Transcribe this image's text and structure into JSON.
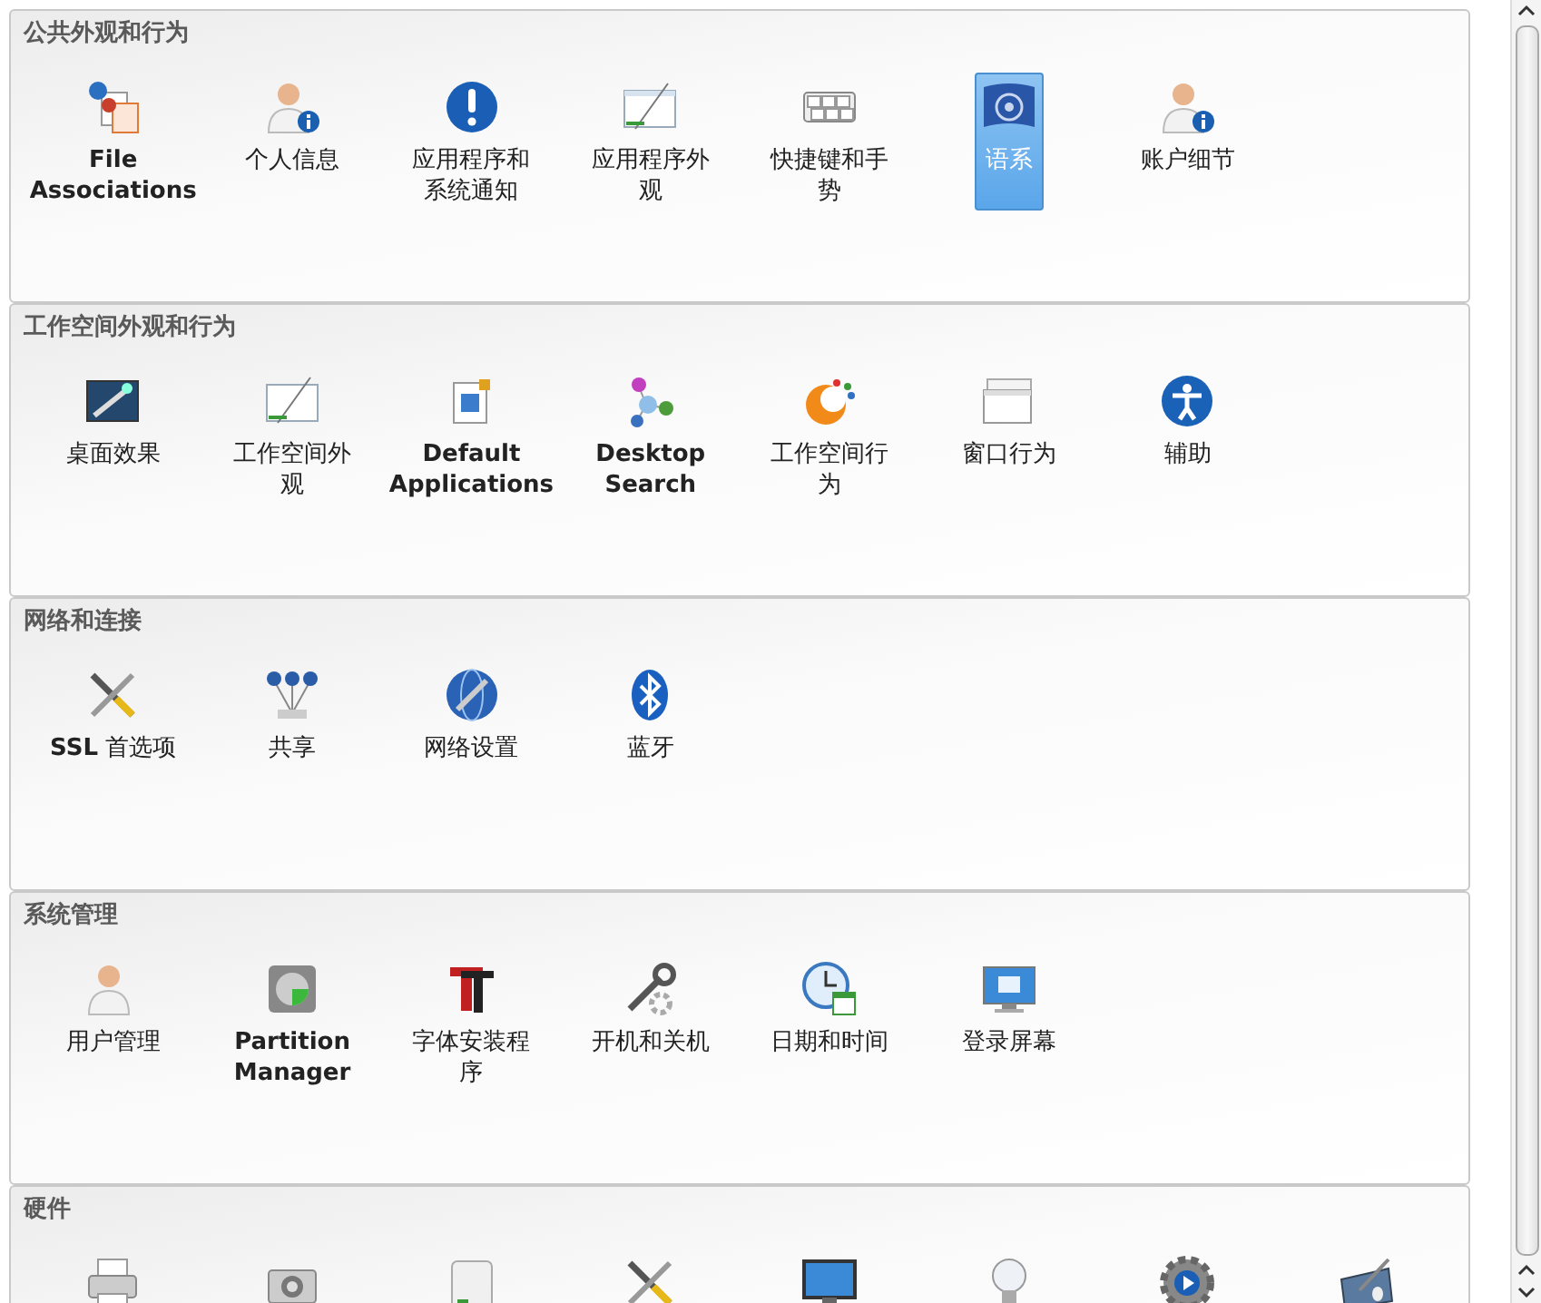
{
  "sections": [
    {
      "title": "公共外观和行为",
      "items": [
        {
          "label": "File Associations",
          "bold": true,
          "selected": false
        },
        {
          "label": "个人信息",
          "bold": false,
          "selected": false
        },
        {
          "label": "应用程序和系统通知",
          "bold": false,
          "selected": false
        },
        {
          "label": "应用程序外观",
          "bold": false,
          "selected": false
        },
        {
          "label": "快捷键和手势",
          "bold": false,
          "selected": false
        },
        {
          "label": "语系",
          "bold": false,
          "selected": true
        },
        {
          "label": "账户细节",
          "bold": false,
          "selected": false
        }
      ]
    },
    {
      "title": "工作空间外观和行为",
      "items": [
        {
          "label": "桌面效果",
          "bold": false,
          "selected": false
        },
        {
          "label": "工作空间外观",
          "bold": false,
          "selected": false
        },
        {
          "label": "Default Applications",
          "bold": true,
          "selected": false
        },
        {
          "label": "Desktop Search",
          "bold": true,
          "selected": false
        },
        {
          "label": "工作空间行为",
          "bold": false,
          "selected": false
        },
        {
          "label": "窗口行为",
          "bold": false,
          "selected": false
        },
        {
          "label": "辅助",
          "bold": false,
          "selected": false
        }
      ]
    },
    {
      "title": "网络和连接",
      "items": [
        {
          "label": "**SSL** 首选项",
          "bold": false,
          "selected": false
        },
        {
          "label": "共享",
          "bold": false,
          "selected": false
        },
        {
          "label": "网络设置",
          "bold": false,
          "selected": false
        },
        {
          "label": "蓝牙",
          "bold": false,
          "selected": false
        }
      ]
    },
    {
      "title": "系统管理",
      "items": [
        {
          "label": "用户管理",
          "bold": false,
          "selected": false
        },
        {
          "label": "Partition Manager",
          "bold": true,
          "selected": false
        },
        {
          "label": "字体安装程序",
          "bold": false,
          "selected": false
        },
        {
          "label": "开机和关机",
          "bold": false,
          "selected": false
        },
        {
          "label": "日期和时间",
          "bold": false,
          "selected": false
        },
        {
          "label": "登录屏幕",
          "bold": false,
          "selected": false
        }
      ]
    },
    {
      "title": "硬件",
      "items": [
        {
          "selected": false
        },
        {
          "selected": false
        },
        {
          "selected": false
        },
        {
          "selected": false
        },
        {
          "selected": false
        },
        {
          "selected": false
        },
        {
          "selected": false
        },
        {
          "selected": false
        }
      ]
    }
  ]
}
